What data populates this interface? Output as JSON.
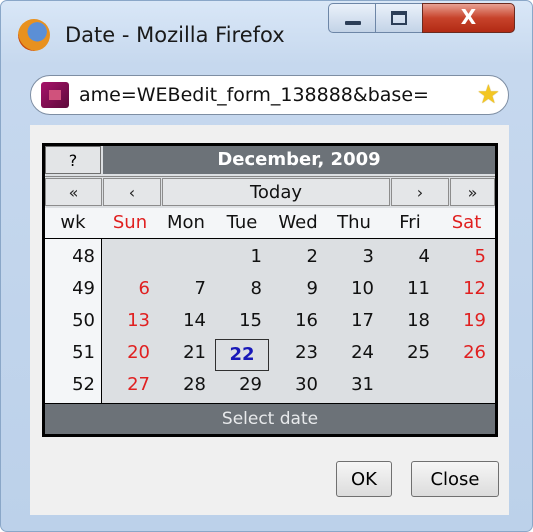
{
  "window": {
    "title": "Date - Mozilla Firefox",
    "controls": {
      "close_glyph": "X"
    }
  },
  "address_bar": {
    "url": "ame=WEBedit_form_138888&base=",
    "bookmark_icon": "star-icon"
  },
  "calendar": {
    "help_label": "?",
    "month_title": "December, 2009",
    "nav": {
      "prev_year": "«",
      "prev_month": "‹",
      "today": "Today",
      "next_month": "›",
      "next_year": "»"
    },
    "week_header": "wk",
    "day_names": [
      "Sun",
      "Mon",
      "Tue",
      "Wed",
      "Thu",
      "Fri",
      "Sat"
    ],
    "weeks": [
      {
        "wk": "48",
        "days": [
          "",
          "",
          "1",
          "2",
          "3",
          "4",
          "5"
        ]
      },
      {
        "wk": "49",
        "days": [
          "6",
          "7",
          "8",
          "9",
          "10",
          "11",
          "12"
        ]
      },
      {
        "wk": "50",
        "days": [
          "13",
          "14",
          "15",
          "16",
          "17",
          "18",
          "19"
        ]
      },
      {
        "wk": "51",
        "days": [
          "20",
          "21",
          "22",
          "23",
          "24",
          "25",
          "26"
        ]
      },
      {
        "wk": "52",
        "days": [
          "27",
          "28",
          "29",
          "30",
          "31",
          "",
          ""
        ]
      }
    ],
    "today_day": "22",
    "status_text": "Select date",
    "colors": {
      "weekend": "#e02020",
      "today": "#1818b8",
      "header_bg": "#6c7278"
    }
  },
  "buttons": {
    "ok": "OK",
    "close": "Close"
  }
}
